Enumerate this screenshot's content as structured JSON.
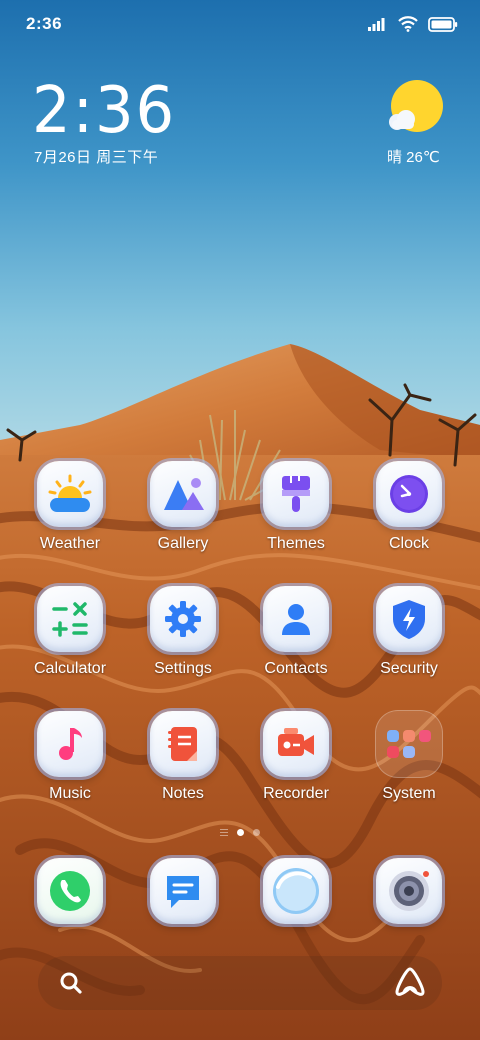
{
  "status_bar": {
    "time": "2:36"
  },
  "clock_widget": {
    "time": "2:36",
    "date": "7月26日 周三下午"
  },
  "weather_widget": {
    "text": "晴 26℃"
  },
  "apps": [
    {
      "label": "Weather",
      "icon": "weather-icon"
    },
    {
      "label": "Gallery",
      "icon": "gallery-icon"
    },
    {
      "label": "Themes",
      "icon": "themes-brush-icon"
    },
    {
      "label": "Clock",
      "icon": "clock-icon"
    },
    {
      "label": "Calculator",
      "icon": "calculator-icon"
    },
    {
      "label": "Settings",
      "icon": "gear-icon"
    },
    {
      "label": "Contacts",
      "icon": "contact-person-icon"
    },
    {
      "label": "Security",
      "icon": "shield-icon"
    },
    {
      "label": "Music",
      "icon": "music-note-icon"
    },
    {
      "label": "Notes",
      "icon": "notes-icon"
    },
    {
      "label": "Recorder",
      "icon": "recorder-camera-icon"
    },
    {
      "label": "System",
      "icon": "folder-icon"
    }
  ],
  "dock": [
    {
      "icon": "phone-icon"
    },
    {
      "icon": "messages-icon"
    },
    {
      "icon": "browser-icon"
    },
    {
      "icon": "camera-icon"
    }
  ],
  "page_indicator": {
    "pages": 2,
    "current": 1
  },
  "colors": {
    "sky_top": "#1f75b3",
    "sky_bottom": "#7bbfdb",
    "sand": "#c96a2b",
    "accent_blue": "#2f7df6",
    "accent_purple": "#7a4dea",
    "accent_red": "#f0533b",
    "accent_green": "#2fcf6a"
  }
}
